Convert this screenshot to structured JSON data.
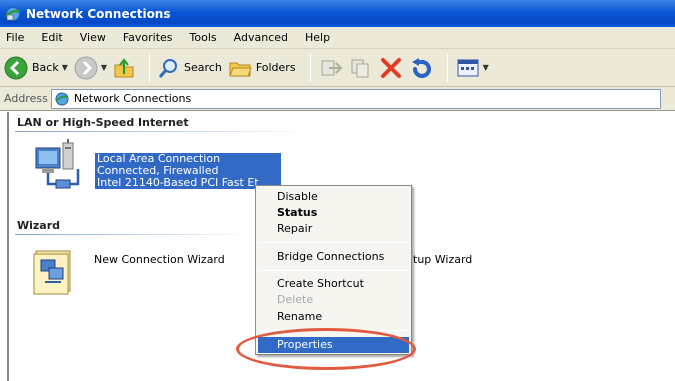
{
  "window": {
    "title": "Network Connections"
  },
  "menubar": {
    "items": [
      "File",
      "Edit",
      "View",
      "Favorites",
      "Tools",
      "Advanced",
      "Help"
    ]
  },
  "toolbar": {
    "back": "Back",
    "search": "Search",
    "folders": "Folders"
  },
  "addressbar": {
    "label": "Address",
    "value": "Network Connections"
  },
  "groups": {
    "lan": "LAN or High-Speed Internet",
    "wizard": "Wizard"
  },
  "connection": {
    "name": "Local Area Connection",
    "status": "Connected, Firewalled",
    "device": "Intel 21140-Based PCI Fast Et"
  },
  "wizards": {
    "new_connection": "New Connection Wizard",
    "partial": "tup Wizard"
  },
  "context_menu": {
    "disable": "Disable",
    "status": "Status",
    "repair": "Repair",
    "bridge": "Bridge Connections",
    "shortcut": "Create Shortcut",
    "delete": "Delete",
    "rename": "Rename",
    "properties": "Properties"
  },
  "colors": {
    "title_bar": "#0a55d6",
    "selection": "#316ac5",
    "highlight_ring": "#e05a3f"
  }
}
